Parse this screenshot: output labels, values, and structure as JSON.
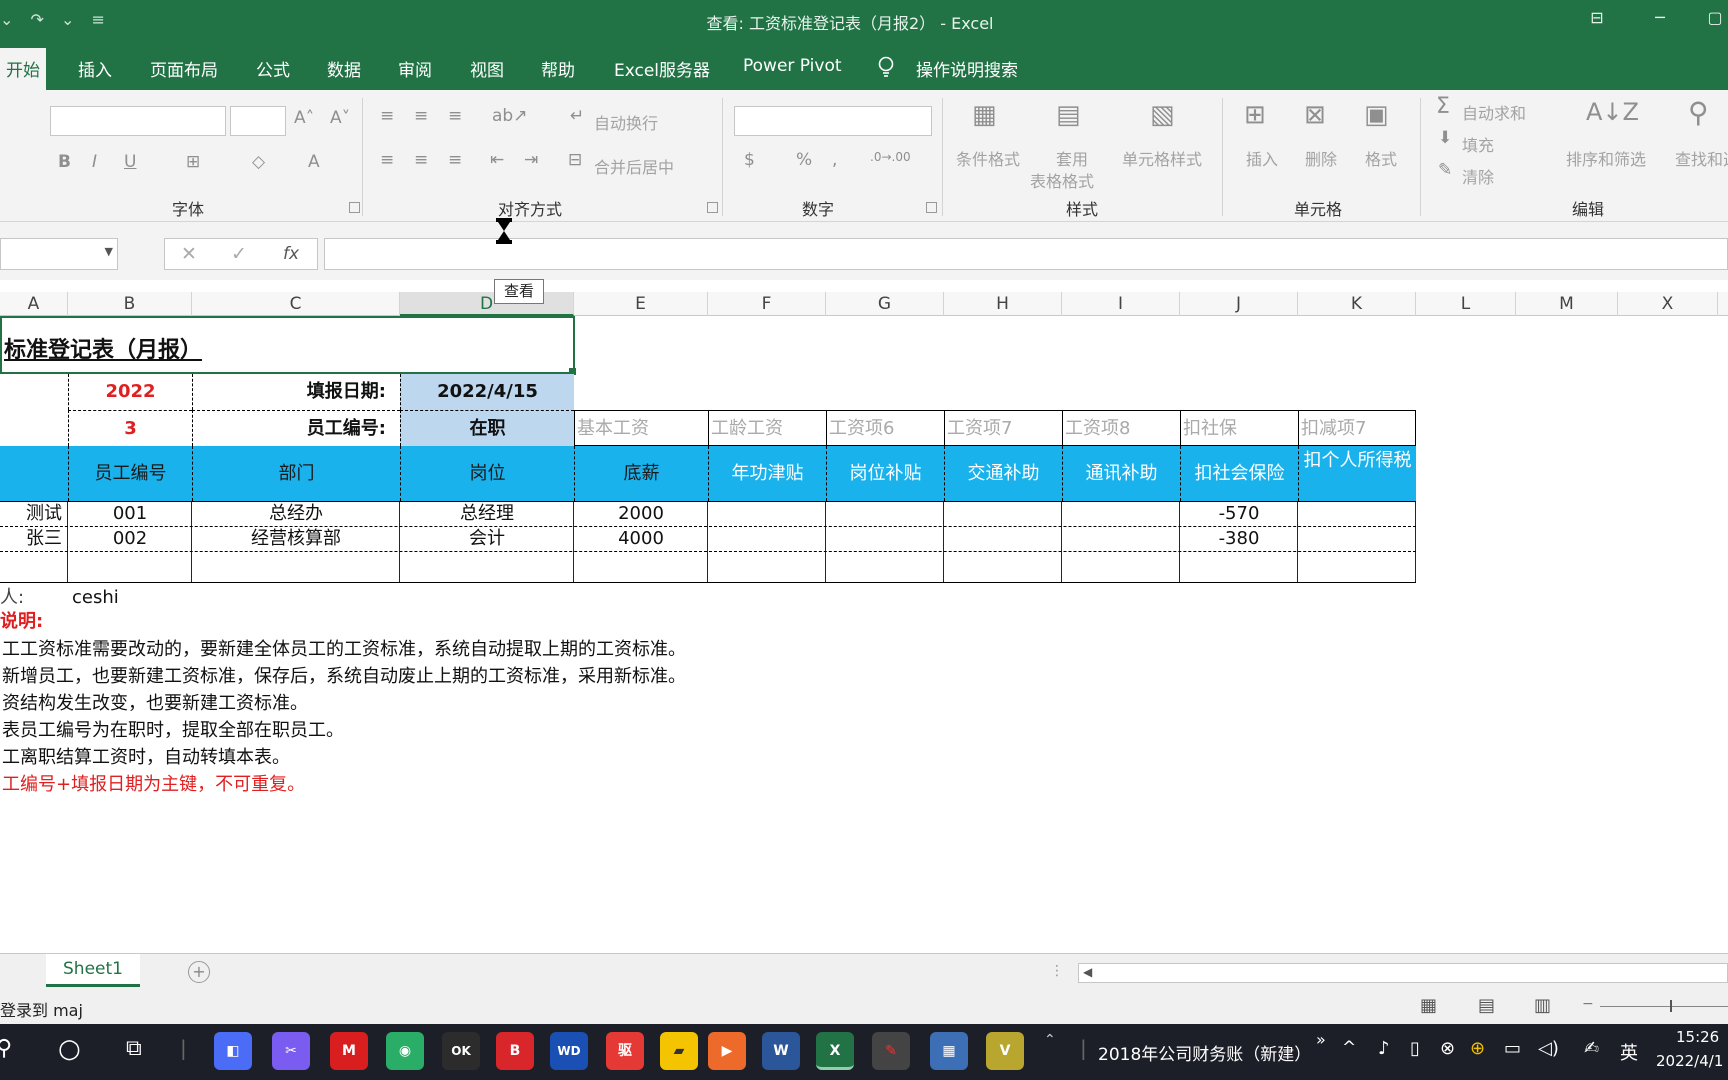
{
  "window": {
    "title": "查看: 工资标准登记表（月报2） - Excel",
    "qat": "⌄ ↷ ⌄ ≡"
  },
  "ribbon": {
    "tabs": [
      "开始",
      "插入",
      "页面布局",
      "公式",
      "数据",
      "审阅",
      "视图",
      "帮助",
      "Excel服务器",
      "Power Pivot"
    ],
    "tell_me": "操作说明搜索",
    "groups": {
      "font": "字体",
      "alignment": "对齐方式",
      "number": "数字",
      "styles": "样式",
      "cells": "单元格",
      "editing": "编辑"
    },
    "labels": {
      "wrap_text": "自动换行",
      "merge_center": "合并后居中",
      "conditional_format": "条件格式",
      "format_as_table_1": "套用",
      "format_as_table_2": "表格格式",
      "cell_styles": "单元格样式",
      "insert": "插入",
      "delete": "删除",
      "format": "格式",
      "autosum": "自动求和",
      "fill": "填充",
      "clear": "清除",
      "sort_filter": "排序和筛选",
      "find_select": "查找和选"
    }
  },
  "formula_bar": {
    "fx": "fx",
    "value": ""
  },
  "tooltip": "查看",
  "columns": [
    "A",
    "B",
    "C",
    "D",
    "E",
    "F",
    "G",
    "H",
    "I",
    "J",
    "K",
    "L",
    "M",
    "X"
  ],
  "sheet": {
    "title": "标准登记表（月报）",
    "year": "2022",
    "date_label": "填报日期:",
    "date_value": "2022/4/15",
    "month": "3",
    "emp_no_label": "员工编号:",
    "emp_status": "在职",
    "item_names": [
      "基本工资",
      "工龄工资",
      "工资项6",
      "工资项7",
      "工资项8",
      "扣社保",
      "扣减项7"
    ],
    "headers": [
      "员工编号",
      "部门",
      "岗位",
      "底薪",
      "年功津贴",
      "岗位补贴",
      "交通补助",
      "通讯补助",
      "扣社会保险",
      "扣个人所得税"
    ],
    "rows": [
      {
        "name": "测试",
        "emp_no": "001",
        "dept": "总经办",
        "position": "总经理",
        "base": "2000",
        "social": "-570"
      },
      {
        "name": "张三",
        "emp_no": "002",
        "dept": "经营核算部",
        "position": "会计",
        "base": "4000",
        "social": "-380"
      }
    ],
    "filler_label": "人:",
    "filler_value": "ceshi",
    "notes_title": "说明:",
    "notes": [
      "工工资标准需要改动的，要新建全体员工的工资标准，系统自动提取上期的工资标准。",
      "新增员工，也要新建工资标准，保存后，系统自动废止上期的工资标准，采用新标准。",
      "资结构发生改变，也要新建工资标准。",
      "表员工编号为在职时，提取全部在职员工。",
      "工离职结算工资时，自动转填本表。",
      "工编号+填报日期为主键，不可重复。"
    ]
  },
  "sheet_tabs": [
    "Sheet1"
  ],
  "status_text": "登录到 maj",
  "taskbar": {
    "app_text": "2018年公司财务账（新建）",
    "ime": "英",
    "time": "15:26",
    "date": "2022/4/1"
  },
  "colors": {
    "excel_green": "#217346",
    "header_blue": "#1ab2ec",
    "input_blue": "#bdd7ee",
    "red": "#e02020"
  }
}
